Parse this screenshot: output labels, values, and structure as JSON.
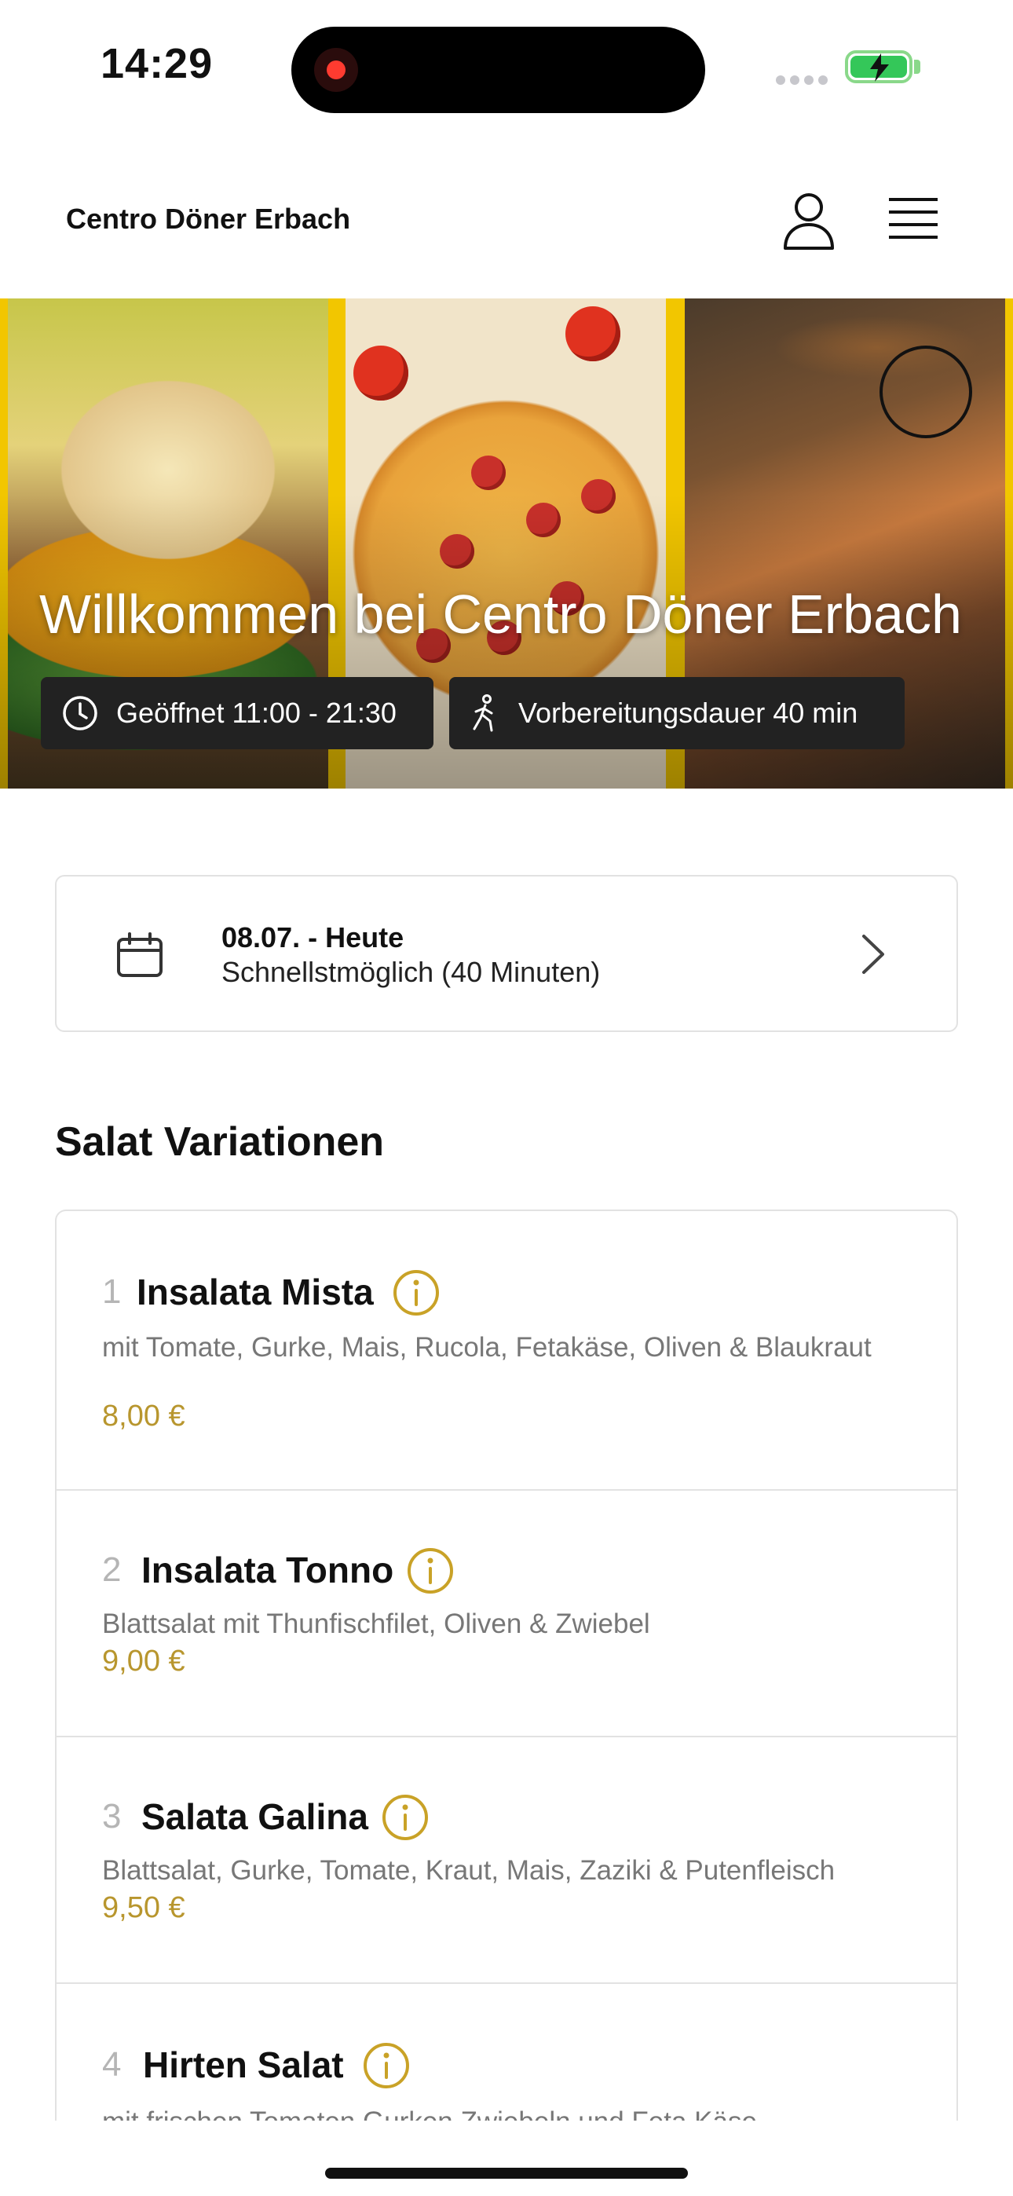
{
  "status_bar": {
    "time": "14:29"
  },
  "header": {
    "brand": "Centro Döner Erbach"
  },
  "hero": {
    "title": "Willkommen bei Centro Döner Erbach",
    "opening_hours": "Geöffnet 11:00 - 21:30",
    "prep_time": "Vorbereitungsdauer 40 min"
  },
  "date_selector": {
    "title": "08.07. - Heute",
    "subtitle": "Schnellstmöglich (40 Minuten)"
  },
  "section": {
    "title": "Salat Variationen",
    "items": [
      {
        "number": "1",
        "name": "Insalata Mista",
        "description": "mit Tomate, Gurke, Mais, Rucola, Fetakäse, Oliven & Blaukraut",
        "price": "8,00 €"
      },
      {
        "number": "2",
        "name": "Insalata Tonno",
        "description": "Blattsalat mit Thunfischfilet, Oliven & Zwiebel",
        "price": "9,00 €"
      },
      {
        "number": "3",
        "name": "Salata Galina",
        "description": "Blattsalat, Gurke, Tomate, Kraut, Mais, Zaziki & Putenfleisch",
        "price": "9,50 €"
      },
      {
        "number": "4",
        "name": "Hirten Salat",
        "description": "mit frischen Tomaten Gurken Zwiebeln und Feta Käse",
        "price": ""
      }
    ]
  },
  "colors": {
    "price": "#b8962e",
    "accent_gold": "#c9a227",
    "hero_border": "#f2c600"
  },
  "icons": {
    "user": "user-icon",
    "menu": "hamburger-menu-icon",
    "clock": "clock-icon",
    "walk": "walking-icon",
    "calendar": "calendar-icon",
    "chevron": "chevron-right-icon",
    "info": "info-icon"
  }
}
